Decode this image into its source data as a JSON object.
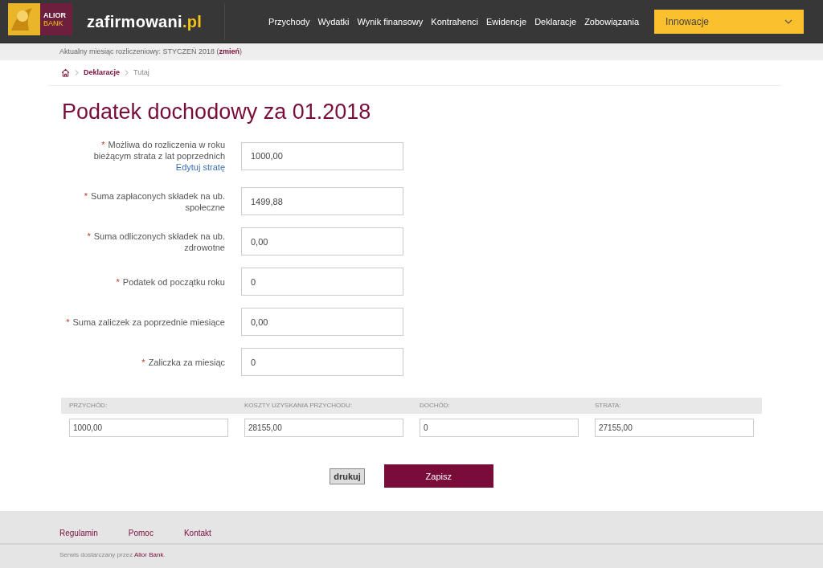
{
  "header": {
    "bank_logo": {
      "line1": "ALIOR",
      "line2": "BANK"
    },
    "brand": {
      "name": "zafirmowani",
      "suffix": ".pl"
    },
    "nav": [
      {
        "label": "Przychody"
      },
      {
        "label": "Wydatki"
      },
      {
        "label": "Wynik finansowy"
      },
      {
        "label": "Kontrahenci"
      },
      {
        "label": "Ewidencje"
      },
      {
        "label": "Deklaracje"
      },
      {
        "label": "Zobowiązania"
      }
    ],
    "dropdown": {
      "label": "Innowacje",
      "expanded": false
    }
  },
  "period_bar": {
    "prefix": "Aktualny miesiąc rozliczeniowy: STYCZEŃ 2018 (",
    "link": "zmień",
    "suffix": ")"
  },
  "breadcrumb": [
    {
      "label": "Deklaracje",
      "kind": "link"
    },
    {
      "label": "Tutaj",
      "kind": "current"
    }
  ],
  "title": "Podatek dochodowy za 01.2018",
  "form": [
    {
      "label": "Możliwa do rozliczenia w roku bieżącym strata z lat poprzednich",
      "required_mark": "*",
      "value": "1000,00",
      "link": "Edytuj stratę"
    },
    {
      "label": "Suma zapłaconych składek na ub. społeczne",
      "required_mark": "*",
      "value": "1499,88"
    },
    {
      "label": "Suma odliczonych składek na ub. zdrowotne",
      "required_mark": "*",
      "value": "0,00"
    },
    {
      "label": "Podatek od początku roku",
      "required_mark": "*",
      "value": "0"
    },
    {
      "label": "Suma zaliczek za poprzednie miesiące",
      "required_mark": "*",
      "value": "0,00"
    },
    {
      "label": "Zaliczka za miesiąc",
      "required_mark": "*",
      "value": "0"
    }
  ],
  "summary": [
    {
      "label": "PRZYCHÓD:",
      "value": "1000,00"
    },
    {
      "label": "KOSZTY UZYSKANIA PRZYCHODU:",
      "value": "28155,00"
    },
    {
      "label": "DOCHÓD:",
      "value": "0"
    },
    {
      "label": "STRATA:",
      "value": "27155,00"
    }
  ],
  "buttons": [
    {
      "label": "drukuj",
      "kind": "secondary"
    },
    {
      "label": "Zapisz",
      "kind": "primary"
    }
  ],
  "footer": {
    "links": [
      {
        "label": "Regulamin"
      },
      {
        "label": "Pomoc"
      },
      {
        "label": "Kontakt"
      }
    ],
    "note": {
      "text": "Serwis dostarczany przez ",
      "link": "Alior Bank",
      "end": "."
    }
  }
}
